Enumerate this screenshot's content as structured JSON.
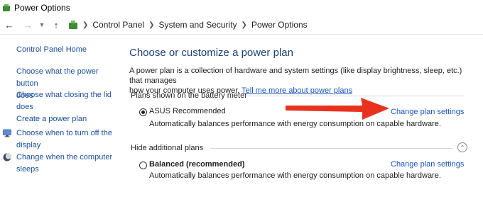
{
  "window": {
    "title": "Power Options"
  },
  "breadcrumb": {
    "items": [
      "Control Panel",
      "System and Security",
      "Power Options"
    ]
  },
  "sidebar": {
    "home": "Control Panel Home",
    "links": [
      {
        "label": "Choose what the power button does",
        "line1": "Choose what the power button",
        "line2": "does"
      },
      {
        "label": "Choose what closing the lid does",
        "line1": "Choose what closing the lid",
        "line2": "does"
      },
      {
        "label": "Create a power plan",
        "line1": "Create a power plan",
        "line2": ""
      },
      {
        "label": "Choose when to turn off the display",
        "line1": "Choose when to turn off the",
        "line2": "display",
        "icon": "monitor-icon"
      },
      {
        "label": "Change when the computer sleeps",
        "line1": "Change when the computer",
        "line2": "sleeps",
        "icon": "moon-icon"
      }
    ]
  },
  "main": {
    "heading": "Choose or customize a power plan",
    "description_line1": "A power plan is a collection of hardware and system settings (like display brightness, sleep, etc.) that manages",
    "description_line2": "how your computer uses power.",
    "tell_more_link": "Tell me more about power plans",
    "battery_meter_label": "Plans shown on the battery meter",
    "hide_plans_label": "Hide additional plans",
    "plans": [
      {
        "name": "ASUS Recommended",
        "selected": true,
        "bold": false,
        "description": "Automatically balances performance with energy consumption on capable hardware.",
        "link": "Change plan settings"
      },
      {
        "name": "Balanced (recommended)",
        "selected": false,
        "bold": true,
        "description": "Automatically balances performance with energy consumption on capable hardware.",
        "link": "Change plan settings"
      }
    ]
  },
  "colors": {
    "link": "#1a55c7",
    "heading": "#1f3f80",
    "annotation_arrow": "#e8321e"
  }
}
